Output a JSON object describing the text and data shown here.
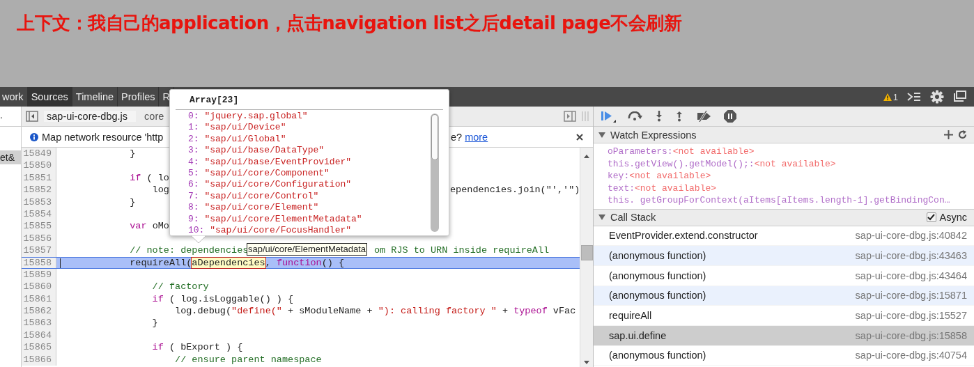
{
  "banner": {
    "text": "上下文：我自己的application，点击navigation list之后detail page不会刷新"
  },
  "toolbar": {
    "tabs": [
      {
        "label": "work",
        "selected": false
      },
      {
        "label": "Sources",
        "selected": true
      },
      {
        "label": "Timeline",
        "selected": false
      },
      {
        "label": "Profiles",
        "selected": false
      },
      {
        "label": "R",
        "selected": false
      }
    ],
    "warning_count": "1"
  },
  "sidebar": {
    "items": [
      {
        "label": ".",
        "selected": false
      },
      {
        "label": "et&",
        "selected": true
      }
    ]
  },
  "editor": {
    "tabs": [
      {
        "label": "sap-ui-core-dbg.js",
        "selected": true
      },
      {
        "label": "core",
        "selected": false
      }
    ],
    "infobar": {
      "text": "Map network resource 'http",
      "tail": "e?",
      "link": "more"
    },
    "tooltip": "sap/ui/core/ElementMetadata",
    "lines": [
      {
        "number": "15849",
        "current": false,
        "segments": [
          {
            "t": "            }",
            "kind": "plain"
          }
        ]
      },
      {
        "number": "15850",
        "current": false
      },
      {
        "number": "15851",
        "current": false,
        "segments": [
          {
            "t": "            if",
            "kind": "keyword"
          },
          {
            "t": " ( lo",
            "kind": "plain"
          }
        ]
      },
      {
        "number": "15852",
        "current": false,
        "segments": [
          {
            "t": "                log",
            "kind": "plain"
          }
        ],
        "tail": [
          {
            "t": "ependencies.join(\"','\")",
            "kind": "plain"
          }
        ]
      },
      {
        "number": "15853",
        "current": false,
        "segments": [
          {
            "t": "            }",
            "kind": "plain"
          }
        ]
      },
      {
        "number": "15854",
        "current": false
      },
      {
        "number": "15855",
        "current": false,
        "segments": [
          {
            "t": "            var",
            "kind": "keyword"
          },
          {
            "t": " oMo",
            "kind": "plain"
          }
        ]
      },
      {
        "number": "15856",
        "current": false
      },
      {
        "number": "15857",
        "current": false,
        "segments": [
          {
            "t": "            // note: dependencies",
            "kind": "comment"
          }
        ],
        "tail2": [
          {
            "t": "om RJS to URN inside requireAll",
            "kind": "comment"
          }
        ]
      },
      {
        "number": "15858",
        "current": true,
        "segments": [
          {
            "t": "            requireAll(",
            "kind": "plain"
          },
          {
            "t": "aDependencies",
            "kind": "highlight"
          },
          {
            "t": ", ",
            "kind": "plain"
          },
          {
            "t": "function",
            "kind": "keyword"
          },
          {
            "t": "() {",
            "kind": "plain"
          }
        ]
      },
      {
        "number": "15859",
        "current": false
      },
      {
        "number": "15860",
        "current": false,
        "segments": [
          {
            "t": "                // factory",
            "kind": "comment"
          }
        ]
      },
      {
        "number": "15861",
        "current": false,
        "segments": [
          {
            "t": "                if",
            "kind": "keyword"
          },
          {
            "t": " ( log.isLoggable() ) {",
            "kind": "plain"
          }
        ]
      },
      {
        "number": "15862",
        "current": false,
        "segments": [
          {
            "t": "                    log.debug(",
            "kind": "plain"
          },
          {
            "t": "\"define(\"",
            "kind": "string"
          },
          {
            "t": " + sModuleName + ",
            "kind": "plain"
          },
          {
            "t": "\"): calling factory \"",
            "kind": "string"
          },
          {
            "t": " + ",
            "kind": "plain"
          },
          {
            "t": "typeof",
            "kind": "keyword"
          },
          {
            "t": " vFac",
            "kind": "plain"
          }
        ]
      },
      {
        "number": "15863",
        "current": false,
        "segments": [
          {
            "t": "                }",
            "kind": "plain"
          }
        ]
      },
      {
        "number": "15864",
        "current": false
      },
      {
        "number": "15865",
        "current": false,
        "segments": [
          {
            "t": "                if",
            "kind": "keyword"
          },
          {
            "t": " ( bExport ) {",
            "kind": "plain"
          }
        ]
      },
      {
        "number": "15866",
        "current": false,
        "segments": [
          {
            "t": "                    // ensure parent namespace",
            "kind": "comment"
          }
        ]
      }
    ]
  },
  "popup": {
    "title": "Array[23]",
    "items": [
      {
        "index": "0:",
        "value": "\"jquery.sap.global\""
      },
      {
        "index": "1:",
        "value": "\"sap/ui/Device\""
      },
      {
        "index": "2:",
        "value": "\"sap/ui/Global\""
      },
      {
        "index": "3:",
        "value": "\"sap/ui/base/DataType\""
      },
      {
        "index": "4:",
        "value": "\"sap/ui/base/EventProvider\""
      },
      {
        "index": "5:",
        "value": "\"sap/ui/core/Component\""
      },
      {
        "index": "6:",
        "value": "\"sap/ui/core/Configuration\""
      },
      {
        "index": "7:",
        "value": "\"sap/ui/core/Control\""
      },
      {
        "index": "8:",
        "value": "\"sap/ui/core/Element\""
      },
      {
        "index": "9:",
        "value": "\"sap/ui/core/ElementMetadata\""
      },
      {
        "index": "10:",
        "value": "\"sap/ui/core/FocusHandler\""
      }
    ]
  },
  "debugger": {
    "watch": {
      "title": "Watch Expressions",
      "expanded": true,
      "items": [
        {
          "name": "oParameters:",
          "value": "<not available>"
        },
        {
          "name": "this.getView().getModel();:",
          "value": "<not available>"
        },
        {
          "name": "key:",
          "value": "<not available>"
        },
        {
          "name": "text:",
          "value": "<not available>"
        },
        {
          "name": "this. getGroupForContext(aItems[aItems.length-1].getBindingCon…"
        }
      ]
    },
    "call_stack": {
      "title": "Call Stack",
      "expanded": true,
      "async": {
        "label": "Async",
        "checked": true
      },
      "frames": [
        {
          "name": "EventProvider.extend.constructor",
          "location": "sap-ui-core-dbg.js:40842",
          "selected": false
        },
        {
          "name": "(anonymous function)",
          "location": "sap-ui-core-dbg.js:43463",
          "selected": false
        },
        {
          "name": "(anonymous function)",
          "location": "sap-ui-core-dbg.js:43464",
          "selected": false
        },
        {
          "name": "(anonymous function)",
          "location": "sap-ui-core-dbg.js:15871",
          "selected": false
        },
        {
          "name": "requireAll",
          "location": "sap-ui-core-dbg.js:15527",
          "selected": false
        },
        {
          "name": "sap.ui.define",
          "location": "sap-ui-core-dbg.js:15858",
          "selected": true
        },
        {
          "name": "(anonymous function)",
          "location": "sap-ui-core-dbg.js:40754",
          "selected": false
        }
      ]
    }
  }
}
